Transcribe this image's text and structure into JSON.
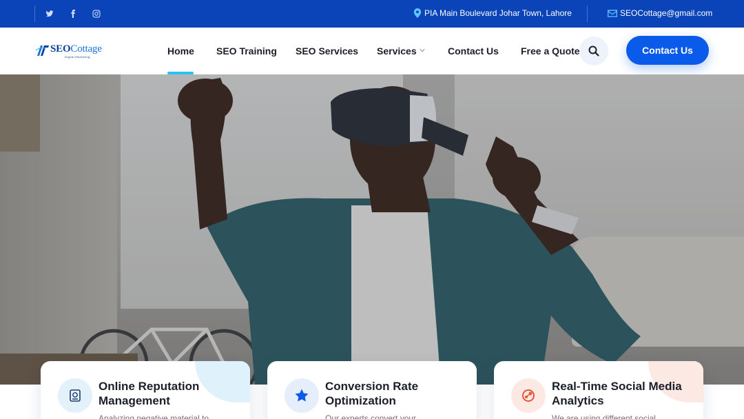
{
  "topbar": {
    "social": [
      {
        "icon": "twitter-icon"
      },
      {
        "icon": "facebook-icon"
      },
      {
        "icon": "instagram-icon"
      }
    ],
    "address": "PIA Main Boulevard Johar Town, Lahore",
    "email": "SEOCottage@gmail.com",
    "colors": {
      "background": "#0a44b8",
      "icon_accent": "#5ec3ff"
    }
  },
  "logo": {
    "brand_seo": "SEO",
    "brand_cottage": "Cottage",
    "tagline": "Digital Marketing"
  },
  "nav": {
    "items": [
      {
        "label": "Home",
        "active": true
      },
      {
        "label": "SEO Training"
      },
      {
        "label": "SEO Services"
      },
      {
        "label": "Services",
        "has_dropdown": true
      },
      {
        "label": "Contact Us"
      },
      {
        "label": "Free a Quote"
      }
    ],
    "contact_button": "Contact Us",
    "colors": {
      "active_underline": "#29c2f0",
      "button": "#0b5bea"
    }
  },
  "hero": {
    "image": "man-wearing-vr-headset"
  },
  "cards": [
    {
      "title": "Online Reputation Management",
      "desc": "Analyzing negative material to",
      "icon": "reputation-icon",
      "icon_bg": "#e3f1fb",
      "icon_color": "#1b3d6e",
      "corner_color": "#dff2fb"
    },
    {
      "title": "Conversion Rate Optimization",
      "desc": "Our experts convert your",
      "icon": "star-icon",
      "icon_bg": "#e6eefb",
      "icon_color": "#0b5bea",
      "corner_color": "#ffffff"
    },
    {
      "title": "Real-Time Social Media Analytics",
      "desc": "We are using different social",
      "icon": "analytics-icon",
      "icon_bg": "#fde9e4",
      "icon_color": "#e8553a",
      "corner_color": "#fde9e4"
    }
  ]
}
